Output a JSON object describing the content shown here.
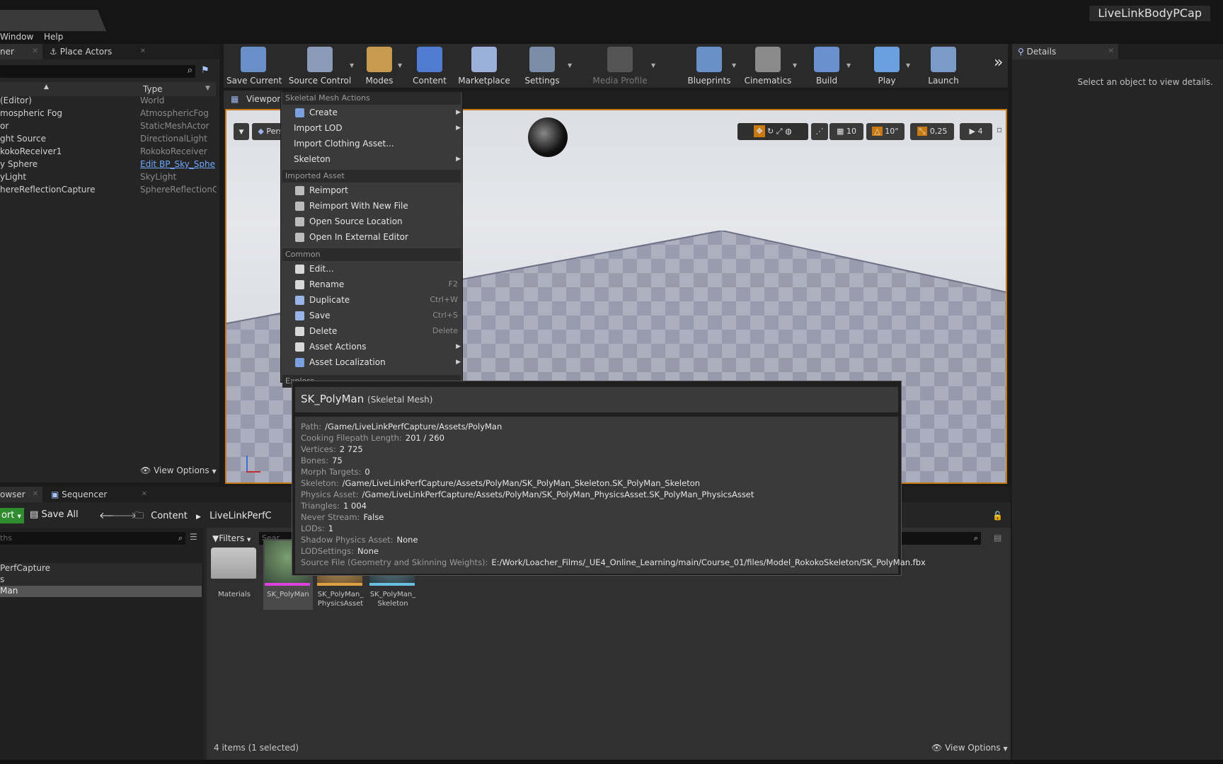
{
  "window": {
    "project_name": "LiveLinkBodyPCap"
  },
  "menu": {
    "items": [
      "Window",
      "Help"
    ]
  },
  "outliner": {
    "tabs": [
      "ner",
      "Place Actors"
    ],
    "column_type": "Type",
    "rows": [
      {
        "name": "(Editor)",
        "type": "World",
        "link": false
      },
      {
        "name": "mospheric Fog",
        "type": "AtmosphericFog",
        "link": false
      },
      {
        "name": "or",
        "type": "StaticMeshActor",
        "link": false
      },
      {
        "name": "ght Source",
        "type": "DirectionalLight",
        "link": false
      },
      {
        "name": "kokoReceiver1",
        "type": "RokokoReceiver",
        "link": false
      },
      {
        "name": "y Sphere",
        "type": "Edit BP_Sky_Sphe",
        "link": true
      },
      {
        "name": "yLight",
        "type": "SkyLight",
        "link": false
      },
      {
        "name": "hereReflectionCapture",
        "type": "SphereReflectionCa",
        "link": false
      }
    ],
    "view_options": "View Options"
  },
  "toolbar": {
    "buttons": [
      {
        "label": "Save Current",
        "icon": "save-icon"
      },
      {
        "label": "Source Control",
        "icon": "source-control-icon"
      },
      {
        "label": "Modes",
        "icon": "modes-icon"
      },
      {
        "label": "Content",
        "icon": "content-icon"
      },
      {
        "label": "Marketplace",
        "icon": "marketplace-icon"
      },
      {
        "label": "Settings",
        "icon": "settings-icon"
      },
      {
        "label": "Media Profile",
        "icon": "media-profile-icon"
      },
      {
        "label": "Blueprints",
        "icon": "blueprints-icon"
      },
      {
        "label": "Cinematics",
        "icon": "cinematics-icon"
      },
      {
        "label": "Build",
        "icon": "build-icon"
      },
      {
        "label": "Play",
        "icon": "play-icon"
      },
      {
        "label": "Launch",
        "icon": "launch-icon"
      }
    ]
  },
  "viewport": {
    "tab_label": "Viewport",
    "perspective": "Pers",
    "grid_snap": "10",
    "rotation_snap": "10°",
    "scale_snap": "0,25",
    "camera_speed": "4"
  },
  "details": {
    "tab": "Details",
    "message": "Select an object to view details."
  },
  "context_menu": {
    "sections": {
      "skeletal": "Skeletal Mesh Actions",
      "imported": "Imported Asset",
      "common": "Common",
      "explore": "Explore"
    },
    "skeletal_items": [
      {
        "label": "Create",
        "submenu": true,
        "icon": "create-icon"
      },
      {
        "label": "Import LOD",
        "submenu": true
      },
      {
        "label": "Import Clothing Asset...",
        "submenu": false
      },
      {
        "label": "Skeleton",
        "submenu": true
      }
    ],
    "imported_items": [
      {
        "label": "Reimport",
        "icon": "reimport-icon"
      },
      {
        "label": "Reimport With New File",
        "icon": "reimport-new-file-icon"
      },
      {
        "label": "Open Source Location",
        "icon": "open-source-location-icon"
      },
      {
        "label": "Open In External Editor",
        "icon": "external-editor-icon"
      }
    ],
    "common_items": [
      {
        "label": "Edit...",
        "shortcut": "",
        "submenu": false,
        "icon": "edit-icon"
      },
      {
        "label": "Rename",
        "shortcut": "F2",
        "submenu": false,
        "icon": "rename-icon"
      },
      {
        "label": "Duplicate",
        "shortcut": "Ctrl+W",
        "submenu": false,
        "icon": "duplicate-icon"
      },
      {
        "label": "Save",
        "shortcut": "Ctrl+S",
        "submenu": false,
        "icon": "save-icon"
      },
      {
        "label": "Delete",
        "shortcut": "Delete",
        "submenu": false,
        "icon": "delete-icon"
      },
      {
        "label": "Asset Actions",
        "shortcut": "",
        "submenu": true,
        "icon": "wrench-icon"
      },
      {
        "label": "Asset Localization",
        "shortcut": "",
        "submenu": true,
        "icon": "globe-icon"
      }
    ]
  },
  "content_browser": {
    "tabs": [
      "owser",
      "Sequencer"
    ],
    "import_label": "ort",
    "save_all": "Save All",
    "breadcrumb": [
      "Content",
      "LiveLinkPerfC"
    ],
    "paths_placeholder": "ths",
    "filters": "Filters",
    "search_placeholder": "Sear",
    "tree": [
      "PerfCapture",
      "s",
      "Man"
    ],
    "assets": [
      {
        "label": "Materials",
        "kind": "folder"
      },
      {
        "label": "SK_PolyMan",
        "kind": "skeletal-mesh"
      },
      {
        "label": "SK_PolyMan_ PhysicsAsset",
        "kind": "physics-asset"
      },
      {
        "label": "SK_PolyMan_ Skeleton",
        "kind": "skeleton"
      }
    ],
    "status": "4 items (1 selected)",
    "view_options": "View Options"
  },
  "tooltip": {
    "title": "SK_PolyMan",
    "subtitle": "(Skeletal Mesh)",
    "lines": [
      {
        "k": "Path:",
        "v": "/Game/LiveLinkPerfCapture/Assets/PolyMan"
      },
      {
        "k": "Cooking Filepath Length:",
        "v": "201 / 260"
      },
      {
        "k": "Vertices:",
        "v": "2 725"
      },
      {
        "k": "Bones:",
        "v": "75"
      },
      {
        "k": "Morph Targets:",
        "v": "0"
      },
      {
        "k": "Skeleton:",
        "v": "/Game/LiveLinkPerfCapture/Assets/PolyMan/SK_PolyMan_Skeleton.SK_PolyMan_Skeleton"
      },
      {
        "k": "Physics Asset:",
        "v": "/Game/LiveLinkPerfCapture/Assets/PolyMan/SK_PolyMan_PhysicsAsset.SK_PolyMan_PhysicsAsset"
      },
      {
        "k": "Triangles:",
        "v": "1 004"
      },
      {
        "k": "Never Stream:",
        "v": "False"
      },
      {
        "k": "LODs:",
        "v": "1"
      },
      {
        "k": "Shadow Physics Asset:",
        "v": "None"
      },
      {
        "k": "LODSettings:",
        "v": "None"
      },
      {
        "k": "Source File (Geometry and Skinning Weights):",
        "v": "E:/Work/Loacher_Films/_UE4_Online_Learning/main/Course_01/files/Model_RokokoSkeleton/SK_PolyMan.fbx"
      }
    ]
  }
}
